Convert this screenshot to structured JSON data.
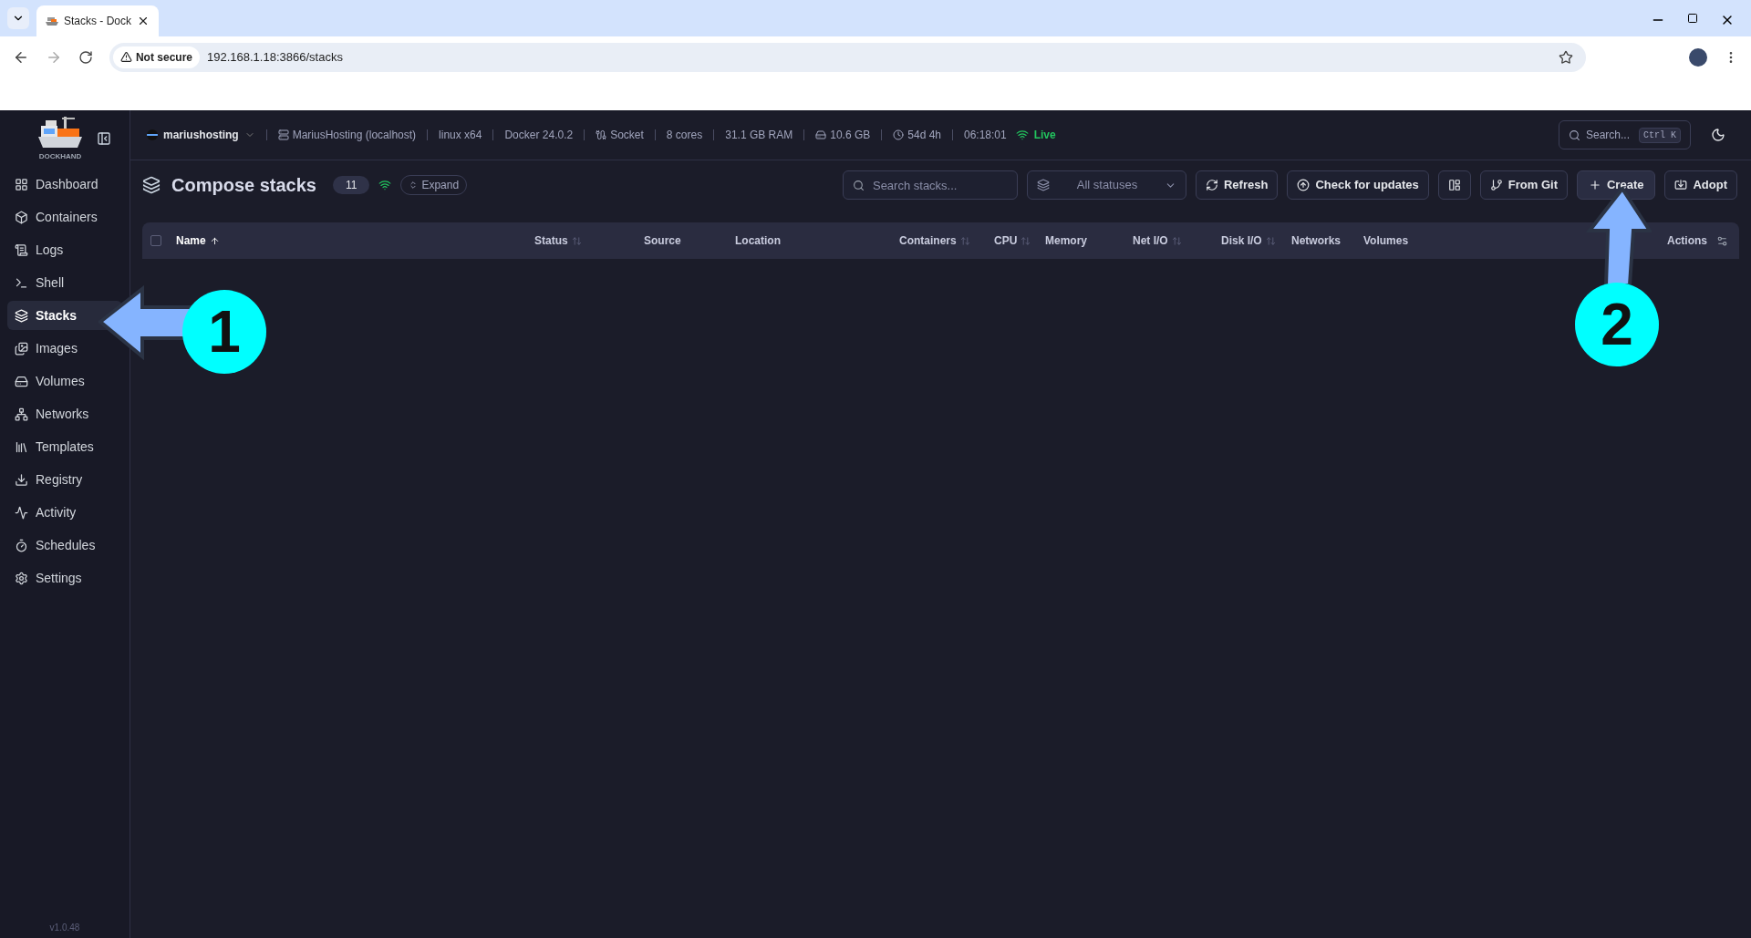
{
  "browser": {
    "tab_title": "Stacks - Dock",
    "security": "Not secure",
    "url": "192.168.1.18:3866/stacks"
  },
  "sidebar": {
    "logo_text": "DOCKHAND",
    "items": [
      {
        "label": "Dashboard",
        "kind": "dashboard",
        "selected": false
      },
      {
        "label": "Containers",
        "kind": "containers",
        "selected": false
      },
      {
        "label": "Logs",
        "kind": "logs",
        "selected": false
      },
      {
        "label": "Shell",
        "kind": "shell",
        "selected": false
      },
      {
        "label": "Stacks",
        "kind": "stacks",
        "selected": true
      },
      {
        "label": "Images",
        "kind": "images",
        "selected": false
      },
      {
        "label": "Volumes",
        "kind": "volumes",
        "selected": false
      },
      {
        "label": "Networks",
        "kind": "networks",
        "selected": false
      },
      {
        "label": "Templates",
        "kind": "templates",
        "selected": false
      },
      {
        "label": "Registry",
        "kind": "registry",
        "selected": false
      },
      {
        "label": "Activity",
        "kind": "activity",
        "selected": false
      },
      {
        "label": "Schedules",
        "kind": "schedules",
        "selected": false
      },
      {
        "label": "Settings",
        "kind": "settings",
        "selected": false
      }
    ],
    "version": "v1.0.48"
  },
  "topbar": {
    "environment": "mariushosting",
    "items": [
      {
        "kind": "host",
        "text": "MariusHosting (localhost)"
      },
      {
        "kind": "plain",
        "text": "linux x64"
      },
      {
        "kind": "plain",
        "text": "Docker 24.0.2"
      },
      {
        "kind": "socket",
        "text": "Socket"
      },
      {
        "kind": "plain",
        "text": "8 cores"
      },
      {
        "kind": "plain",
        "text": "31.1 GB RAM"
      },
      {
        "kind": "disk",
        "text": "10.6 GB"
      },
      {
        "kind": "uptime",
        "text": "54d 4h"
      },
      {
        "kind": "plain",
        "text": "06:18:01"
      }
    ],
    "live": "Live",
    "search_placeholder": "Search...",
    "search_shortcut": "Ctrl K"
  },
  "page": {
    "title": "Compose stacks",
    "count": "11",
    "expand": "Expand",
    "search_placeholder": "Search stacks...",
    "status_filter": "All statuses",
    "buttons": [
      {
        "kind": "refresh",
        "label": "Refresh"
      },
      {
        "kind": "updates",
        "label": "Check for updates"
      },
      {
        "kind": "layout"
      },
      {
        "kind": "git",
        "label": "From Git"
      },
      {
        "kind": "create",
        "label": "Create"
      },
      {
        "kind": "adopt",
        "label": "Adopt"
      }
    ]
  },
  "table": {
    "select_all_checked": false,
    "columns": [
      {
        "label": "Name",
        "sortable": true,
        "sorted": true
      },
      {
        "label": "Status",
        "sortable": true,
        "sorted": false
      },
      {
        "label": "Source",
        "sortable": false,
        "sorted": false
      },
      {
        "label": "Location",
        "sortable": false,
        "sorted": false
      },
      {
        "label": "Containers",
        "sortable": true,
        "sorted": false
      },
      {
        "label": "CPU",
        "sortable": true,
        "sorted": false
      },
      {
        "label": "Memory",
        "sortable": false,
        "sorted": false
      },
      {
        "label": "Net I/O",
        "sortable": true,
        "sorted": false
      },
      {
        "label": "Disk I/O",
        "sortable": true,
        "sorted": false
      },
      {
        "label": "Networks",
        "sortable": false,
        "sorted": false
      },
      {
        "label": "Volumes",
        "sortable": false,
        "sorted": false
      },
      {
        "label": "Actions",
        "sortable": false,
        "sorted": false
      }
    ]
  },
  "annotations": [
    {
      "number": "1",
      "kind": "left"
    },
    {
      "number": "2",
      "kind": "up"
    }
  ]
}
